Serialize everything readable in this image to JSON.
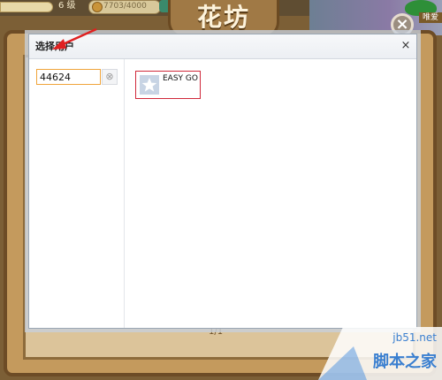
{
  "game": {
    "level_label": "6 级",
    "coins": "7703/4000",
    "title": "花坊",
    "user_tag": "唯爱",
    "close_symbol": "×",
    "pager": "1/1"
  },
  "dialog": {
    "title": "选择用户",
    "close_symbol": "×",
    "search": {
      "value": "44624",
      "clear_symbol": "⊗"
    },
    "results": [
      {
        "name": "EASY GO",
        "avatar_icon": "star-icon"
      }
    ]
  },
  "watermark": {
    "url": "jb51.net",
    "name": "脚本之家"
  },
  "colors": {
    "input_border": "#f0a43a",
    "highlight_border": "#d0283a",
    "arrow": "#e02020",
    "watermark": "#3a7fd0"
  }
}
